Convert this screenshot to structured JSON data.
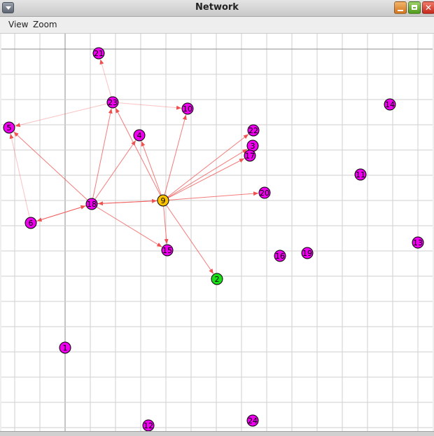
{
  "window": {
    "title": "Network",
    "controls": [
      "minimize",
      "maximize",
      "close"
    ]
  },
  "menubar": {
    "items": [
      {
        "label": "View"
      },
      {
        "label": "Zoom"
      }
    ]
  },
  "colors": {
    "default_node": "#ee00ee",
    "selected_node": "#ffc400",
    "highlight_node": "#19e019",
    "edge": "#f05050"
  },
  "graph": {
    "nodes": [
      {
        "id": "1",
        "label": "1",
        "state": "default"
      },
      {
        "id": "2",
        "label": "2",
        "state": "highlight"
      },
      {
        "id": "3",
        "label": "3",
        "state": "default"
      },
      {
        "id": "4",
        "label": "4",
        "state": "default"
      },
      {
        "id": "5",
        "label": "5",
        "state": "default"
      },
      {
        "id": "6",
        "label": "6",
        "state": "default"
      },
      {
        "id": "9",
        "label": "9",
        "state": "selected"
      },
      {
        "id": "10",
        "label": "10",
        "state": "default"
      },
      {
        "id": "11",
        "label": "11",
        "state": "default"
      },
      {
        "id": "12",
        "label": "12",
        "state": "default"
      },
      {
        "id": "13",
        "label": "13",
        "state": "default"
      },
      {
        "id": "14",
        "label": "14",
        "state": "default"
      },
      {
        "id": "15",
        "label": "15",
        "state": "default"
      },
      {
        "id": "16",
        "label": "16",
        "state": "default"
      },
      {
        "id": "17",
        "label": "17",
        "state": "default"
      },
      {
        "id": "18",
        "label": "18",
        "state": "default"
      },
      {
        "id": "19",
        "label": "19",
        "state": "default"
      },
      {
        "id": "20",
        "label": "20",
        "state": "default"
      },
      {
        "id": "21",
        "label": "21",
        "state": "default"
      },
      {
        "id": "22",
        "label": "22",
        "state": "default"
      },
      {
        "id": "23",
        "label": "23",
        "state": "default"
      },
      {
        "id": "24",
        "label": "24",
        "state": "default"
      }
    ],
    "edges": [
      {
        "from": "9",
        "to": "2"
      },
      {
        "from": "9",
        "to": "15"
      },
      {
        "from": "9",
        "to": "4"
      },
      {
        "from": "9",
        "to": "10"
      },
      {
        "from": "9",
        "to": "22"
      },
      {
        "from": "9",
        "to": "3"
      },
      {
        "from": "9",
        "to": "17"
      },
      {
        "from": "9",
        "to": "20"
      },
      {
        "from": "9",
        "to": "18"
      },
      {
        "from": "9",
        "to": "23"
      },
      {
        "from": "18",
        "to": "9"
      },
      {
        "from": "18",
        "to": "6"
      },
      {
        "from": "18",
        "to": "5"
      },
      {
        "from": "18",
        "to": "23"
      },
      {
        "from": "18",
        "to": "4"
      },
      {
        "from": "18",
        "to": "15"
      },
      {
        "from": "6",
        "to": "18"
      },
      {
        "from": "6",
        "to": "5"
      },
      {
        "from": "23",
        "to": "5"
      },
      {
        "from": "23",
        "to": "10"
      },
      {
        "from": "23",
        "to": "21"
      }
    ]
  }
}
